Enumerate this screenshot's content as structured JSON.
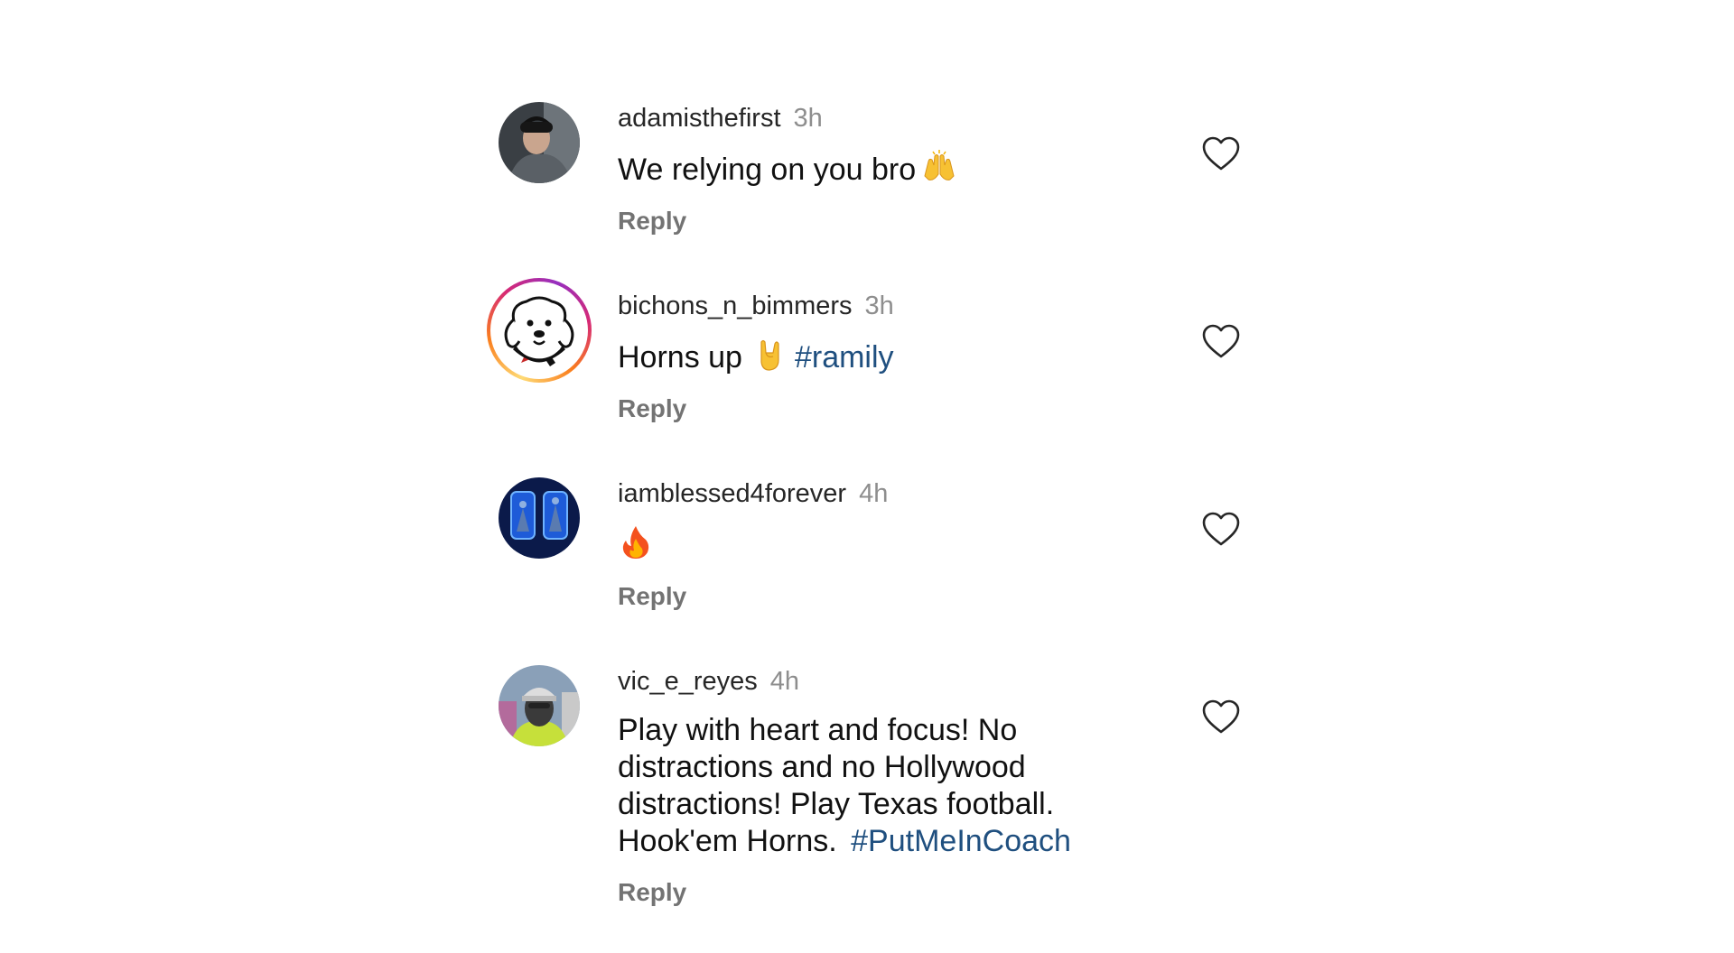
{
  "comments": [
    {
      "username": "adamisthefirst",
      "time": "3h",
      "text": "We relying on you bro",
      "emoji": "raising-hands",
      "reply": "Reply",
      "avatar": "man-in-car-photo"
    },
    {
      "username": "bichons_n_bimmers",
      "time": "3h",
      "text": "Horns up",
      "emoji": "horns-hand",
      "hashtag": "#ramily",
      "reply": "Reply",
      "avatar": "cartoon-dog"
    },
    {
      "username": "iamblessed4forever",
      "time": "4h",
      "text": "",
      "emoji": "fire",
      "reply": "Reply",
      "avatar": "blue-neon-photo"
    },
    {
      "username": "vic_e_reyes",
      "time": "4h",
      "text": "Play with heart and focus! No distractions and no Hollywood distractions! Play Texas football. Hook'em Horns.",
      "hashtag": "#PutMeInCoach",
      "reply": "Reply",
      "avatar": "man-in-cap-photo"
    }
  ],
  "colors": {
    "hashtag": "#1f4f7f",
    "muted": "#8e8e8e",
    "reply": "#737373"
  }
}
